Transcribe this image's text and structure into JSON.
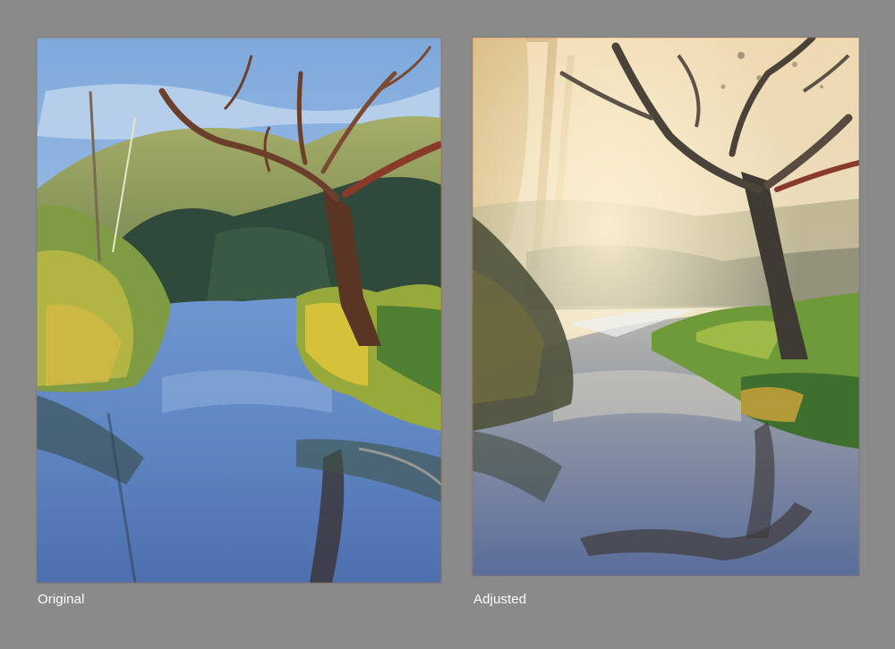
{
  "captions": {
    "original": "Original",
    "adjusted": "Adjusted"
  },
  "colors": {
    "background": "#8a8a8a",
    "caption_text": "#ffffff"
  }
}
